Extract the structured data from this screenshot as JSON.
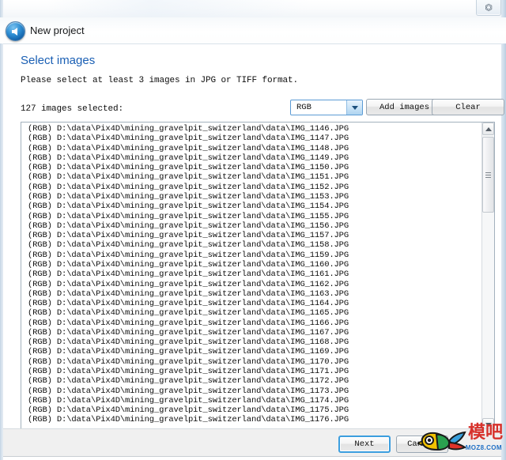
{
  "window": {
    "close_label": "✖",
    "close_icon": "close-icon"
  },
  "nav": {
    "back_icon": "back-arrow-icon",
    "caption": "New project"
  },
  "page": {
    "title": "Select images",
    "instruction": "Please select at least 3 images in JPG or TIFF format.",
    "selected_count_label": "127 images selected:"
  },
  "toolbar": {
    "color_mode": {
      "selected": "RGB",
      "options": [
        "RGB"
      ],
      "caret_icon": "chevron-down-icon"
    },
    "add_images_label": "Add images",
    "clear_label": "Clear"
  },
  "image_list": {
    "rows": [
      "(RGB) D:\\data\\Pix4D\\mining_gravelpit_switzerland\\data\\IMG_1146.JPG",
      "(RGB) D:\\data\\Pix4D\\mining_gravelpit_switzerland\\data\\IMG_1147.JPG",
      "(RGB) D:\\data\\Pix4D\\mining_gravelpit_switzerland\\data\\IMG_1148.JPG",
      "(RGB) D:\\data\\Pix4D\\mining_gravelpit_switzerland\\data\\IMG_1149.JPG",
      "(RGB) D:\\data\\Pix4D\\mining_gravelpit_switzerland\\data\\IMG_1150.JPG",
      "(RGB) D:\\data\\Pix4D\\mining_gravelpit_switzerland\\data\\IMG_1151.JPG",
      "(RGB) D:\\data\\Pix4D\\mining_gravelpit_switzerland\\data\\IMG_1152.JPG",
      "(RGB) D:\\data\\Pix4D\\mining_gravelpit_switzerland\\data\\IMG_1153.JPG",
      "(RGB) D:\\data\\Pix4D\\mining_gravelpit_switzerland\\data\\IMG_1154.JPG",
      "(RGB) D:\\data\\Pix4D\\mining_gravelpit_switzerland\\data\\IMG_1155.JPG",
      "(RGB) D:\\data\\Pix4D\\mining_gravelpit_switzerland\\data\\IMG_1156.JPG",
      "(RGB) D:\\data\\Pix4D\\mining_gravelpit_switzerland\\data\\IMG_1157.JPG",
      "(RGB) D:\\data\\Pix4D\\mining_gravelpit_switzerland\\data\\IMG_1158.JPG",
      "(RGB) D:\\data\\Pix4D\\mining_gravelpit_switzerland\\data\\IMG_1159.JPG",
      "(RGB) D:\\data\\Pix4D\\mining_gravelpit_switzerland\\data\\IMG_1160.JPG",
      "(RGB) D:\\data\\Pix4D\\mining_gravelpit_switzerland\\data\\IMG_1161.JPG",
      "(RGB) D:\\data\\Pix4D\\mining_gravelpit_switzerland\\data\\IMG_1162.JPG",
      "(RGB) D:\\data\\Pix4D\\mining_gravelpit_switzerland\\data\\IMG_1163.JPG",
      "(RGB) D:\\data\\Pix4D\\mining_gravelpit_switzerland\\data\\IMG_1164.JPG",
      "(RGB) D:\\data\\Pix4D\\mining_gravelpit_switzerland\\data\\IMG_1165.JPG",
      "(RGB) D:\\data\\Pix4D\\mining_gravelpit_switzerland\\data\\IMG_1166.JPG",
      "(RGB) D:\\data\\Pix4D\\mining_gravelpit_switzerland\\data\\IMG_1167.JPG",
      "(RGB) D:\\data\\Pix4D\\mining_gravelpit_switzerland\\data\\IMG_1168.JPG",
      "(RGB) D:\\data\\Pix4D\\mining_gravelpit_switzerland\\data\\IMG_1169.JPG",
      "(RGB) D:\\data\\Pix4D\\mining_gravelpit_switzerland\\data\\IMG_1170.JPG",
      "(RGB) D:\\data\\Pix4D\\mining_gravelpit_switzerland\\data\\IMG_1171.JPG",
      "(RGB) D:\\data\\Pix4D\\mining_gravelpit_switzerland\\data\\IMG_1172.JPG",
      "(RGB) D:\\data\\Pix4D\\mining_gravelpit_switzerland\\data\\IMG_1173.JPG",
      "(RGB) D:\\data\\Pix4D\\mining_gravelpit_switzerland\\data\\IMG_1174.JPG",
      "(RGB) D:\\data\\Pix4D\\mining_gravelpit_switzerland\\data\\IMG_1175.JPG",
      "(RGB) D:\\data\\Pix4D\\mining_gravelpit_switzerland\\data\\IMG_1176.JPG"
    ],
    "scrollbar": {
      "up_icon": "scroll-up-icon",
      "down_icon": "scroll-down-icon"
    }
  },
  "footer": {
    "next_label": "Next",
    "cancel_label": "Cancel"
  },
  "watermark": {
    "brand_cn": "模吧",
    "url": "MOZ8.COM",
    "logo_icon": "bird-logo-icon"
  },
  "colors": {
    "accent_blue": "#1a5fb4",
    "focus_blue": "#3c9ede",
    "combo_border": "#5b9bd5",
    "watermark_red": "#d7312b",
    "watermark_blue": "#1f6fc4"
  }
}
